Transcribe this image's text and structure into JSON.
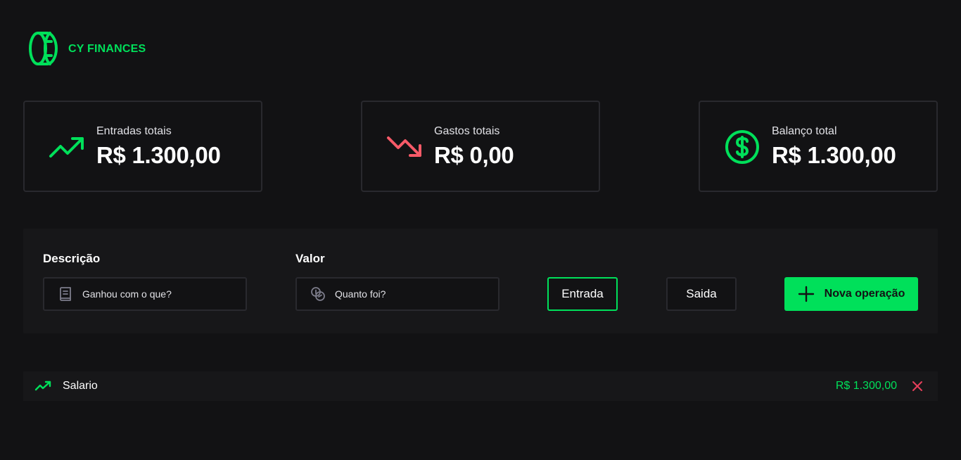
{
  "brand": {
    "name": "CY FINANCES",
    "logo_icon": "coin-icon",
    "color": "#00e05a"
  },
  "summary": {
    "income": {
      "label": "Entradas totais",
      "value": "R$ 1.300,00",
      "icon": "trend-up-icon",
      "color": "#00e05a"
    },
    "expenses": {
      "label": "Gastos totais",
      "value": "R$ 0,00",
      "icon": "trend-down-icon",
      "color": "#f75a68"
    },
    "balance": {
      "label": "Balanço total",
      "value": "R$ 1.300,00",
      "icon": "currency-dollar-circle-icon",
      "color": "#00e05a"
    }
  },
  "form": {
    "description": {
      "label": "Descrição",
      "placeholder": "Ganhou com o que?",
      "value": "",
      "icon": "book-icon"
    },
    "amount": {
      "label": "Valor",
      "placeholder": "Quanto foi?",
      "value": "",
      "icon": "coins-icon"
    },
    "types": {
      "income_label": "Entrada",
      "expense_label": "Saida",
      "selected": "Entrada"
    },
    "submit_label": "Nova operação",
    "submit_icon": "plus-icon"
  },
  "transactions": [
    {
      "type": "income",
      "description": "Salario",
      "amount": "R$ 1.300,00",
      "icon": "trend-up-icon",
      "delete_icon": "close-icon",
      "delete_color": "#e83f5b"
    }
  ],
  "colors": {
    "background": "#121214",
    "panel": "#171719",
    "border": "#29292e",
    "accent": "#00e05a",
    "danger": "#f75a68"
  }
}
